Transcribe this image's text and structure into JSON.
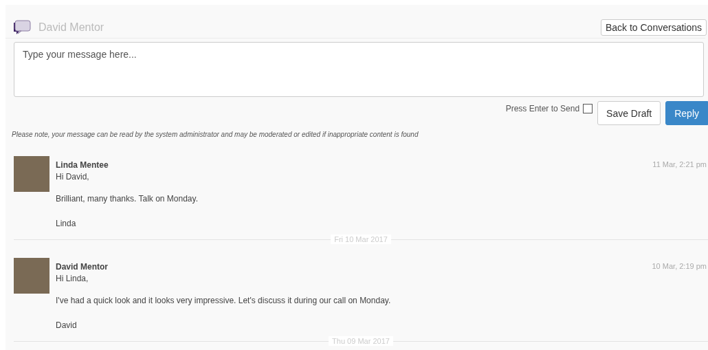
{
  "conversation": {
    "title": "David Mentor"
  },
  "back_button": {
    "label": "Back to Conversations"
  },
  "composer": {
    "placeholder": "Type your message here...",
    "enter_to_send": {
      "label": "Press Enter to Send",
      "checked": false
    },
    "buttons": [
      {
        "label": "Save Draft",
        "kind": "default"
      },
      {
        "label": "Reply",
        "kind": "primary"
      }
    ]
  },
  "note": "Please note, your message can be read by the system administrator and may be moderated or edited if inappropriate content is found",
  "timeline": [
    {
      "kind": "message",
      "author": "Linda Mentee",
      "time": "11 Mar, 2:21 pm",
      "lines": [
        "Hi David,",
        "Brilliant, many thanks. Talk on Monday.",
        "Linda"
      ]
    },
    {
      "kind": "divider",
      "label": "Fri 10 Mar 2017"
    },
    {
      "kind": "message",
      "author": "David Mentor",
      "time": "10 Mar, 2:19 pm",
      "lines": [
        "Hi Linda,",
        "I've had a quick look and it looks very impressive. Let's discuss it during our call on Monday.",
        "David"
      ]
    },
    {
      "kind": "divider",
      "label": "Thu 09 Mar 2017"
    }
  ]
}
